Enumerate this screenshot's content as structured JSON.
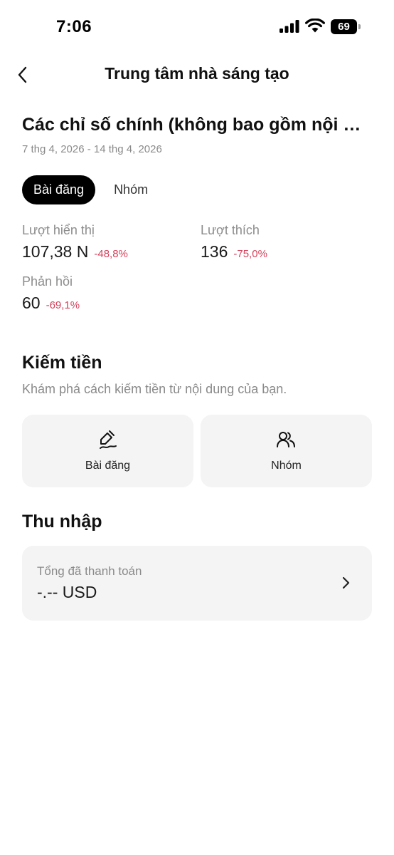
{
  "status_bar": {
    "time": "7:06",
    "battery": "69"
  },
  "header": {
    "title": "Trung tâm nhà sáng tạo"
  },
  "metrics": {
    "title": "Các chỉ số chính (không bao gồm nội dung trả phí)",
    "date_range": "7 thg 4, 2026 - 14 thg 4, 2026",
    "tabs": [
      {
        "label": "Bài đăng",
        "selected": true
      },
      {
        "label": "Nhóm",
        "selected": false
      }
    ],
    "stats": [
      {
        "label": "Lượt hiển thị",
        "value": "107,38 N",
        "change": "-48,8%"
      },
      {
        "label": "Lượt thích",
        "value": "136",
        "change": "-75,0%"
      },
      {
        "label": "Phản hồi",
        "value": "60",
        "change": "-69,1%"
      }
    ]
  },
  "monetize": {
    "title": "Kiếm tiền",
    "subtitle": "Khám phá cách kiếm tiền từ nội dung của bạn.",
    "cards": [
      {
        "label": "Bài đăng",
        "icon": "edit-icon"
      },
      {
        "label": "Nhóm",
        "icon": "people-icon"
      }
    ]
  },
  "income": {
    "title": "Thu nhập",
    "label": "Tổng đã thanh toán",
    "value": "-.-- USD"
  },
  "colors": {
    "accent": "#000000",
    "negative": "#d4415b",
    "card_bg": "#f4f4f4",
    "muted_text": "#8a8a8a"
  }
}
